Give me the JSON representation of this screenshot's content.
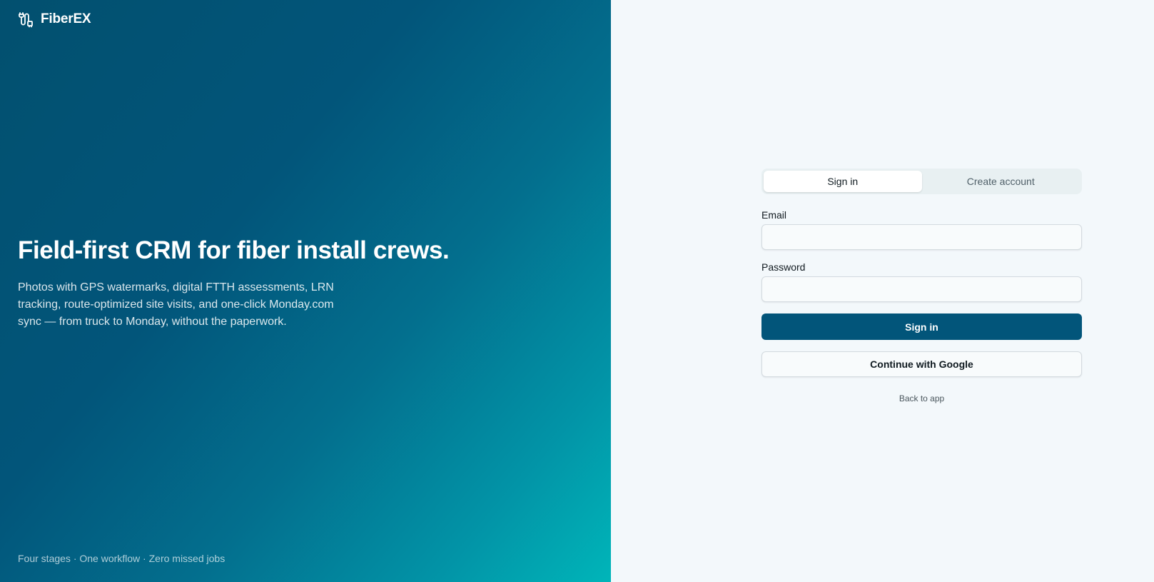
{
  "brand": {
    "name": "FiberEX",
    "icon": "cable-plug-icon"
  },
  "hero": {
    "title": "Field-first CRM for fiber install crews.",
    "description": "Photos with GPS watermarks, digital FTTH assessments, LRN tracking, route-optimized site visits, and one-click Monday.com sync — from truck to Monday, without the paperwork.",
    "footer": "Four stages · One workflow · Zero missed jobs"
  },
  "auth": {
    "tabs": [
      {
        "label": "Sign in",
        "active": true
      },
      {
        "label": "Create account",
        "active": false
      }
    ],
    "email": {
      "label": "Email",
      "value": "",
      "placeholder": ""
    },
    "password": {
      "label": "Password",
      "value": "",
      "placeholder": ""
    },
    "submit_label": "Sign in",
    "google_label": "Continue with Google",
    "back_label": "Back to app"
  },
  "colors": {
    "primary": "#02557a",
    "hero_gradient_start": "#02506f",
    "hero_gradient_end": "#00b5b9",
    "panel_background": "#f3f8fb"
  }
}
